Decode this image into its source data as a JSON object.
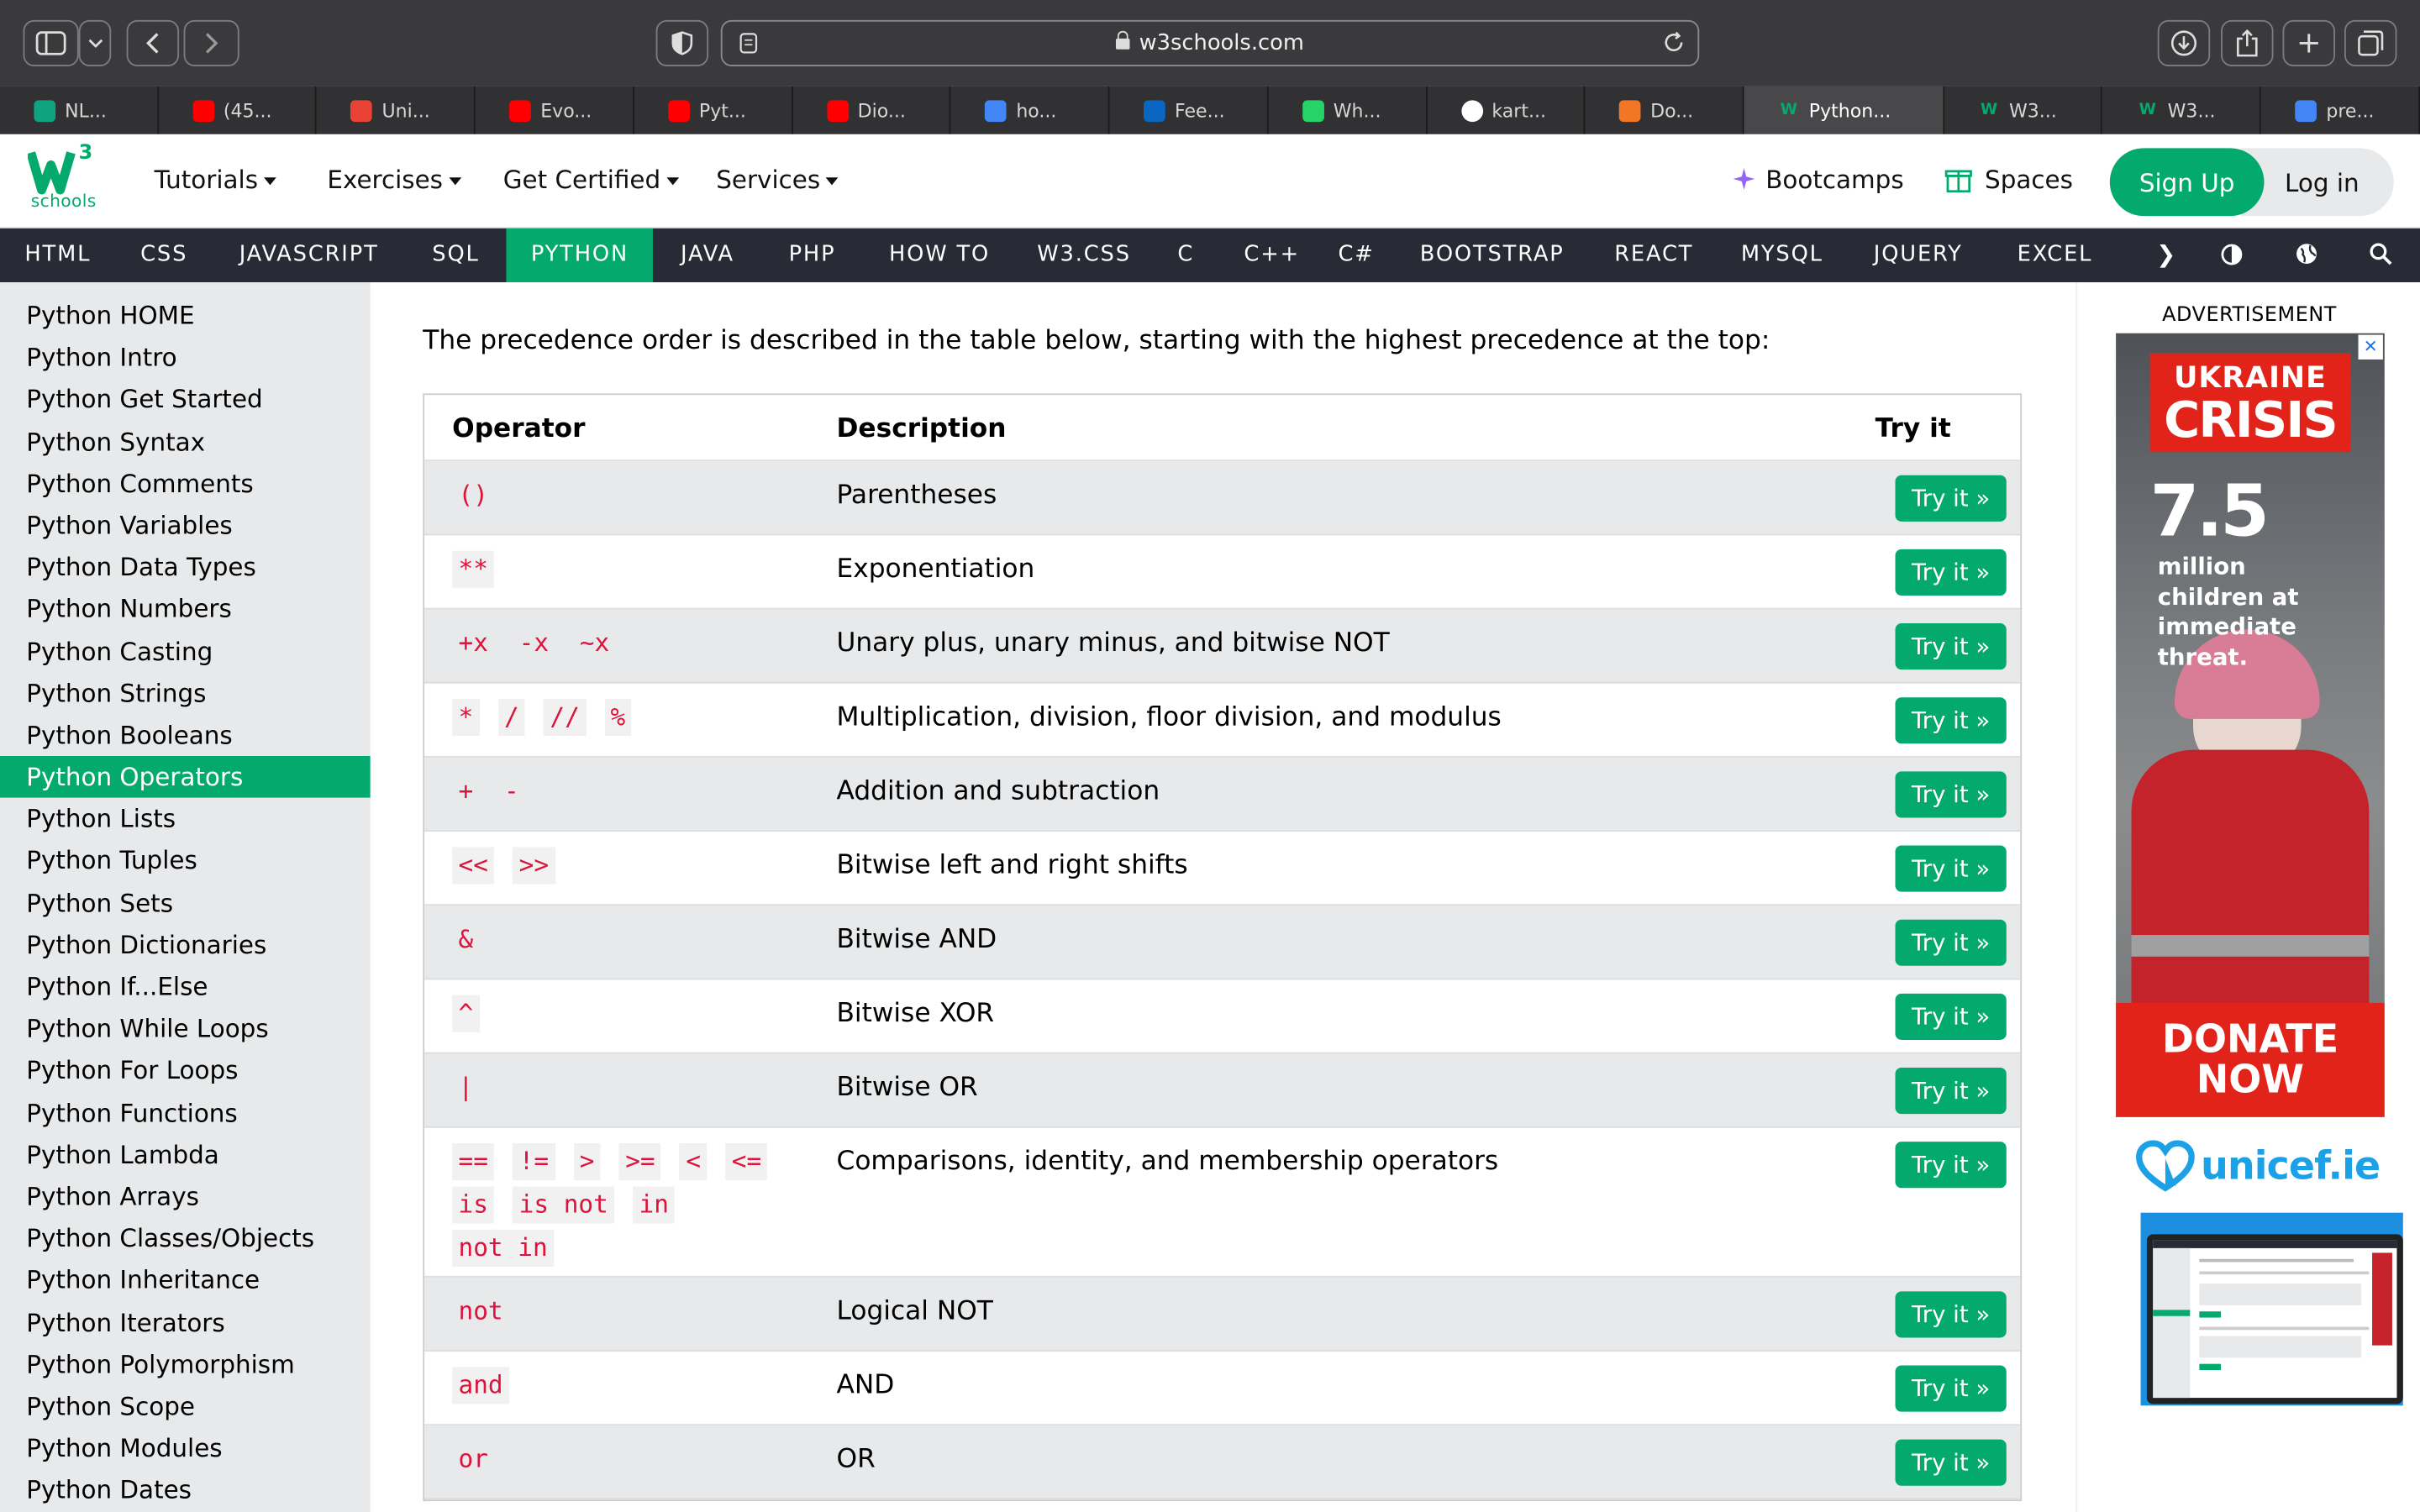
{
  "browser": {
    "url": "w3schools.com",
    "tabs": [
      {
        "label": "NL...",
        "icon": "openai-icon",
        "color": "#10a37f"
      },
      {
        "label": "(45...",
        "icon": "youtube-icon",
        "color": "#ff0000"
      },
      {
        "label": "Uni...",
        "icon": "gmail-icon",
        "color": "#ea4335"
      },
      {
        "label": "Evo...",
        "icon": "youtube-icon",
        "color": "#ff0000"
      },
      {
        "label": "Pyt...",
        "icon": "youtube-icon",
        "color": "#ff0000"
      },
      {
        "label": "Dio...",
        "icon": "youtube-icon",
        "color": "#ff0000"
      },
      {
        "label": "ho...",
        "icon": "google-icon",
        "color": "#4285f4"
      },
      {
        "label": "Fee...",
        "icon": "linkedin-icon",
        "color": "#0a66c2"
      },
      {
        "label": "Wh...",
        "icon": "whatsapp-icon",
        "color": "#25d366"
      },
      {
        "label": "kart...",
        "icon": "github-icon",
        "color": "#ffffff"
      },
      {
        "label": "Do...",
        "icon": "jupyter-icon",
        "color": "#f37626"
      },
      {
        "label": "Python...",
        "icon": "w3schools-icon",
        "color": "#04aa6d",
        "active": true
      },
      {
        "label": "W3...",
        "icon": "w3schools-icon",
        "color": "#04aa6d"
      },
      {
        "label": "W3...",
        "icon": "w3schools-icon",
        "color": "#04aa6d"
      },
      {
        "label": "pre...",
        "icon": "google-icon",
        "color": "#4285f4"
      }
    ]
  },
  "topnav": {
    "logo_sup": "3",
    "logo_text": "schools",
    "menus": [
      "Tutorials",
      "Exercises",
      "Get Certified",
      "Services"
    ],
    "bootcamps": "Bootcamps",
    "spaces": "Spaces",
    "signup": "Sign Up",
    "login": "Log in"
  },
  "subjects": [
    "HTML",
    "CSS",
    "JAVASCRIPT",
    "SQL",
    "PYTHON",
    "JAVA",
    "PHP",
    "HOW TO",
    "W3.CSS",
    "C",
    "C++",
    "C#",
    "BOOTSTRAP",
    "REACT",
    "MYSQL",
    "JQUERY",
    "EXCEL"
  ],
  "subject_active": "PYTHON",
  "sidebar": {
    "items": [
      "Python HOME",
      "Python Intro",
      "Python Get Started",
      "Python Syntax",
      "Python Comments",
      "Python Variables",
      "Python Data Types",
      "Python Numbers",
      "Python Casting",
      "Python Strings",
      "Python Booleans",
      "Python Operators",
      "Python Lists",
      "Python Tuples",
      "Python Sets",
      "Python Dictionaries",
      "Python If...Else",
      "Python While Loops",
      "Python For Loops",
      "Python Functions",
      "Python Lambda",
      "Python Arrays",
      "Python Classes/Objects",
      "Python Inheritance",
      "Python Iterators",
      "Python Polymorphism",
      "Python Scope",
      "Python Modules",
      "Python Dates"
    ],
    "active": "Python Operators"
  },
  "content": {
    "intro": "The precedence order is described in the table below, starting with the highest precedence at the top:",
    "headers": {
      "operator": "Operator",
      "description": "Description",
      "try": "Try it"
    },
    "try_label": "Try it »",
    "rows": [
      {
        "ops": [
          "()"
        ],
        "desc": "Parentheses"
      },
      {
        "ops": [
          "**"
        ],
        "desc": "Exponentiation"
      },
      {
        "ops": [
          "+x",
          "-x",
          "~x"
        ],
        "desc": "Unary plus, unary minus, and bitwise NOT"
      },
      {
        "ops": [
          "*",
          "/",
          "//",
          "%"
        ],
        "desc": "Multiplication, division, floor division, and modulus"
      },
      {
        "ops": [
          "+",
          "-"
        ],
        "desc": "Addition and subtraction"
      },
      {
        "ops": [
          "<<",
          ">>"
        ],
        "desc": "Bitwise left and right shifts"
      },
      {
        "ops": [
          "&"
        ],
        "desc": "Bitwise AND"
      },
      {
        "ops": [
          "^"
        ],
        "desc": "Bitwise XOR"
      },
      {
        "ops": [
          "|"
        ],
        "desc": "Bitwise OR"
      },
      {
        "ops": [
          "==",
          "!=",
          ">",
          ">=",
          "<",
          "<=",
          "is",
          "is not",
          "in",
          "not in"
        ],
        "desc": "Comparisons, identity, and membership operators"
      },
      {
        "ops": [
          "not"
        ],
        "desc": "Logical NOT"
      },
      {
        "ops": [
          "and"
        ],
        "desc": "AND"
      },
      {
        "ops": [
          "or"
        ],
        "desc": "OR"
      }
    ]
  },
  "ad": {
    "label": "ADVERTISEMENT",
    "headline1": "UKRAINE",
    "headline2": "CRISIS",
    "stat": "7.5",
    "stat_text": "million children at immediate threat.",
    "donate1": "DONATE",
    "donate2": "NOW",
    "brand": "unicef.ie",
    "close": "✕"
  }
}
